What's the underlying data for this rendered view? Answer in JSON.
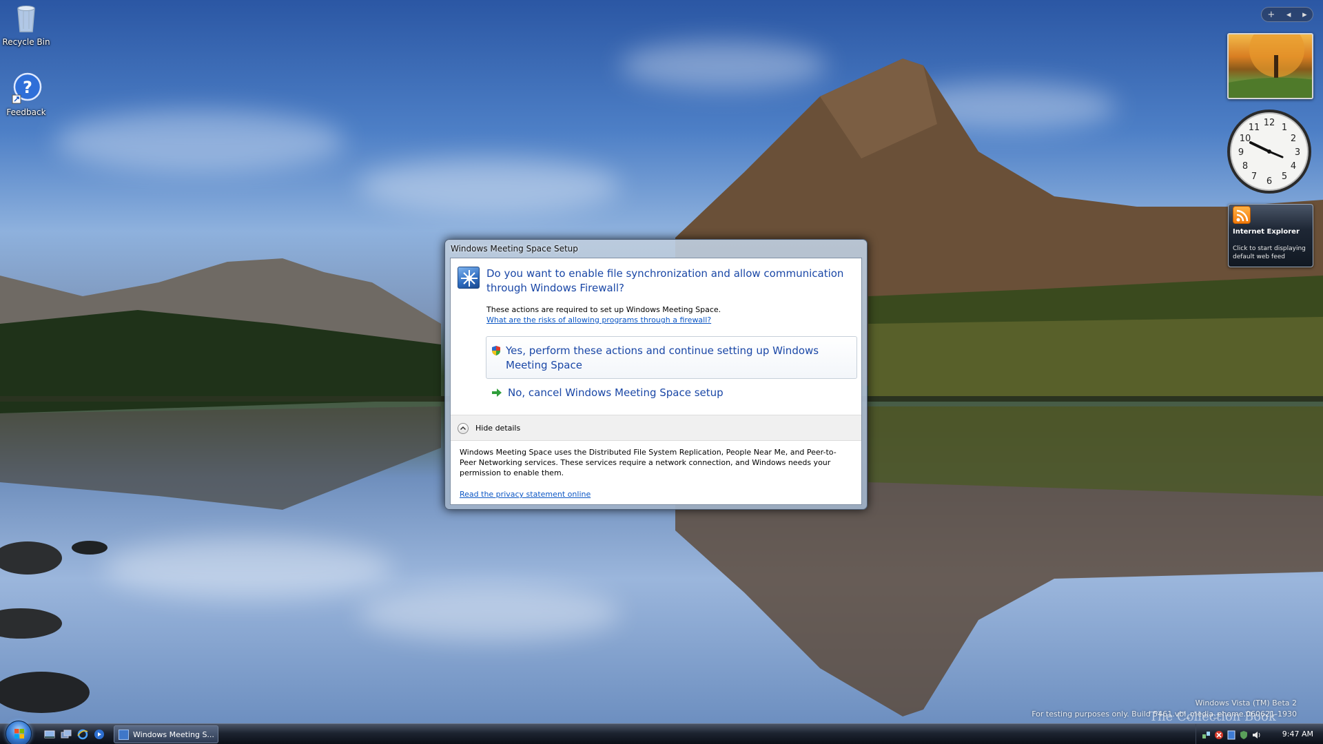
{
  "desktop": {
    "icons": [
      {
        "label": "Recycle Bin",
        "icon": "recycle-bin-icon"
      },
      {
        "label": "Feedback",
        "icon": "help-feedback-icon"
      }
    ]
  },
  "sidebar": {
    "controls": {
      "add": "+",
      "prev": "◂",
      "next": "▸"
    },
    "clock": {
      "numerals": [
        "12",
        "1",
        "2",
        "3",
        "4",
        "5",
        "6",
        "7",
        "8",
        "9",
        "10",
        "11"
      ]
    },
    "feed": {
      "title": "Internet Explorer",
      "message": "Click to start displaying default web feed"
    }
  },
  "dialog": {
    "title": "Windows Meeting Space Setup",
    "heading": "Do you want to enable file synchronization and allow communication through Windows Firewall?",
    "subtext": "These actions are required to set up Windows Meeting Space.",
    "risk_link": "What are the risks of allowing programs through a firewall?",
    "yes_label": "Yes, perform these actions and continue setting up Windows Meeting Space",
    "no_label": "No, cancel Windows Meeting Space setup",
    "details_label": "Hide details",
    "details_text": "Windows Meeting Space uses the Distributed File System Replication, People Near Me, and Peer-to-Peer Networking services. These services require a network connection, and Windows needs your permission to enable them.",
    "privacy_link": "Read the privacy statement online"
  },
  "watermark": {
    "line1": "Windows Vista (TM) Beta 2",
    "line2": "For testing purposes only. Build 5461.vbl_media_ehome.060621-1930",
    "book": "The Collection Book"
  },
  "taskbar": {
    "task_label": "Windows Meeting S...",
    "clock": "9:47 AM"
  },
  "colors": {
    "link": "#0b56c4",
    "heading": "#1a47a6",
    "accent": "#3a7fd6"
  }
}
